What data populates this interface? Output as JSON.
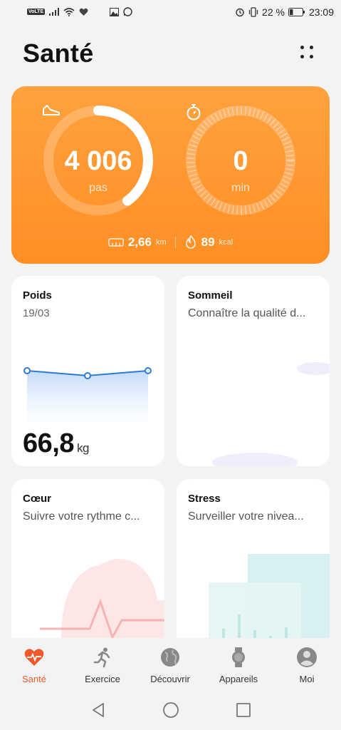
{
  "status_bar": {
    "volte": "VoLTE",
    "battery": "22 %",
    "time": "23:09"
  },
  "header": {
    "title": "Santé"
  },
  "activity": {
    "steps_value": "4 006",
    "steps_unit": "pas",
    "steps_progress": 0.4,
    "minutes_value": "0",
    "minutes_unit": "min",
    "minutes_progress": 0,
    "distance_value": "2,66",
    "distance_unit": "km",
    "calories_value": "89",
    "calories_unit": "kcal"
  },
  "cards": {
    "poids": {
      "title": "Poids",
      "date": "19/03",
      "value": "66,8",
      "unit": "kg"
    },
    "sommeil": {
      "title": "Sommeil",
      "subtitle": "Connaître la qualité d..."
    },
    "coeur": {
      "title": "Cœur",
      "subtitle": "Suivre votre rythme c..."
    },
    "stress": {
      "title": "Stress",
      "subtitle": "Surveiller votre nivea..."
    }
  },
  "bottom_nav": {
    "items": [
      {
        "label": "Santé",
        "icon": "heart-pulse-icon",
        "active": true
      },
      {
        "label": "Exercice",
        "icon": "running-icon",
        "active": false
      },
      {
        "label": "Découvrir",
        "icon": "globe-icon",
        "active": false
      },
      {
        "label": "Appareils",
        "icon": "watch-icon",
        "active": false
      },
      {
        "label": "Moi",
        "icon": "person-icon",
        "active": false
      }
    ]
  },
  "colors": {
    "accent": "#ff9730",
    "nav_active": "#f05a2a",
    "weight_line": "#2e7ad6",
    "sleep_moon": "#cfcaf4"
  }
}
